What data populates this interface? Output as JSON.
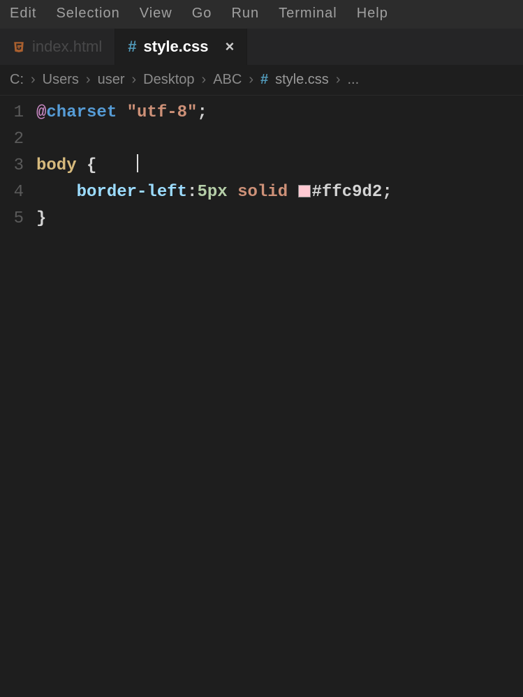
{
  "menu": {
    "edit": "Edit",
    "selection": "Selection",
    "view": "View",
    "go": "Go",
    "run": "Run",
    "terminal": "Terminal",
    "help": "Help"
  },
  "tabs": {
    "inactive_label": "index.html",
    "active_label": "style.css",
    "active_icon_char": "#",
    "close_char": "×"
  },
  "breadcrumb": {
    "seg0": "C:",
    "seg1": "Users",
    "seg2": "user",
    "seg3": "Desktop",
    "seg4": "ABC",
    "file_icon": "#",
    "file": "style.css",
    "tail": "...",
    "chev": "›"
  },
  "lines": {
    "n1": "1",
    "n2": "2",
    "n3": "3",
    "n4": "4",
    "n5": "5"
  },
  "code": {
    "at": "@",
    "charset_kw": "charset",
    "charset_val": "\"utf-8\"",
    "semi": ";",
    "sel_body": "body",
    "brace_open": "{",
    "brace_close": "}",
    "prop": "border-left",
    "colon": ":",
    "val_size": "5px",
    "val_style": "solid",
    "val_color": "#ffc9d2",
    "swatch_color": "#ffc9d2"
  }
}
